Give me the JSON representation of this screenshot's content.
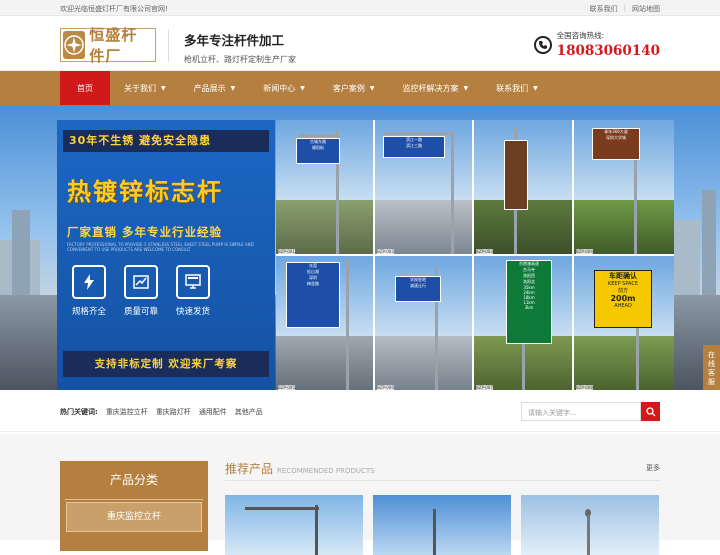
{
  "topbar": {
    "welcome": "欢迎光临恒盛灯杆厂有限公司官网!",
    "links": [
      "联系我们",
      "网站地图"
    ]
  },
  "header": {
    "logo_text": "恒盛杆件厂",
    "slogan_title": "多年专注杆件加工",
    "slogan_sub": "枪机立杆、路灯杆定制生产厂家",
    "hotline_label": "全国咨询热线:",
    "hotline_number": "18083060140"
  },
  "nav": {
    "items": [
      {
        "label": "首页",
        "active": true,
        "caret": false
      },
      {
        "label": "关于我们",
        "caret": true
      },
      {
        "label": "产品展示",
        "caret": true
      },
      {
        "label": "新闻中心",
        "caret": true
      },
      {
        "label": "客户案例",
        "caret": true
      },
      {
        "label": "监控杆解决方案",
        "caret": true
      },
      {
        "label": "联系我们",
        "caret": true
      }
    ]
  },
  "banner": {
    "tagline": "30年不生锈 避免安全隐患",
    "headline": "热镀锌标志杆",
    "subline": "厂家直销 多年专业行业经验",
    "fine_print": "FACTORY PROFESSIONAL TO PROVIDE 5 STAINLESS STEEL SHEET STEEL PUMP IS SIMPLE AND CONVENIENT TO USE PRODUCTS ARE WELCOME TO CONSULT",
    "features": [
      {
        "label": "规格齐全",
        "icon": "lightning-icon"
      },
      {
        "label": "质量可靠",
        "icon": "chart-icon"
      },
      {
        "label": "快速发货",
        "icon": "monitor-icon"
      }
    ],
    "bottom_banner": "支持非标定制 欢迎来厂考察",
    "photos": [
      {
        "caption": "BZP-001",
        "signs": [
          "古城东路",
          "顺阳街"
        ]
      },
      {
        "caption": "BZP-002",
        "signs": [
          "滨江一路",
          "滨江三路"
        ]
      },
      {
        "caption": "BZP-003",
        "signs": []
      },
      {
        "caption": "BZP-004",
        "signs": [
          "青年366大道",
          "深圳大学城"
        ]
      },
      {
        "caption": "BZP-005",
        "signs": [
          "东莞",
          "松山湖",
          "深圳",
          "梅坐路"
        ]
      },
      {
        "caption": "BZP-006",
        "signs": [
          "学校驻地",
          "减速让行"
        ]
      },
      {
        "caption": "BZP-007",
        "signs": [
          "京港澳高速",
          "台马寺",
          "洛阳西",
          "洛阳北"
        ]
      },
      {
        "caption": "BZP-008",
        "signs": [
          "车距确认",
          "KEEP SPACE",
          "前方",
          "200m",
          "AHEAD"
        ]
      }
    ],
    "sign_values": [
      "35km",
      "24km",
      "18km",
      "11km",
      "3km"
    ],
    "side_tab": "在线客服"
  },
  "hot": {
    "label": "热门关键词:",
    "keywords": [
      "重庆监控立杆",
      "重庆路灯杆",
      "通用配件",
      "其他产品"
    ],
    "search_placeholder": "请输入关键字..."
  },
  "products": {
    "category_title": "产品分类",
    "category_item": "重庆监控立杆",
    "recommended_title": "推荐产品",
    "recommended_en": "RECOMMENDED PRODUCTS",
    "more": "更多"
  },
  "colors": {
    "brand_gold": "#b5803f",
    "accent_red": "#d01a1a",
    "promo_blue": "#1d67c2"
  }
}
